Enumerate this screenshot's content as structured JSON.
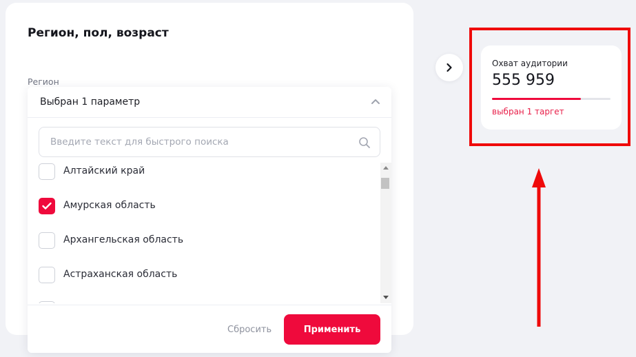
{
  "section": {
    "title": "Регион, пол, возраст"
  },
  "region": {
    "label": "Регион",
    "selected_text": "Выбран 1 параметр",
    "search_placeholder": "Введите текст для быстрого поиска",
    "items": [
      {
        "label": "Алтайский край",
        "checked": false
      },
      {
        "label": "Амурская область",
        "checked": true
      },
      {
        "label": "Архангельская область",
        "checked": false
      },
      {
        "label": "Астраханская область",
        "checked": false
      },
      {
        "label": "",
        "checked": false
      }
    ],
    "reset_label": "Сбросить",
    "apply_label": "Применить"
  },
  "reach": {
    "title": "Охват аудитории",
    "value": "555 959",
    "progress_fraction": 0.75,
    "subtitle": "выбран 1 таргет"
  },
  "colors": {
    "accent": "#ef0a3c",
    "annotation": "#ef0a0a"
  },
  "icons": {
    "search": "search-icon",
    "collapse": "chevron-up-icon",
    "next": "chevron-right-icon",
    "check": "check-icon"
  }
}
